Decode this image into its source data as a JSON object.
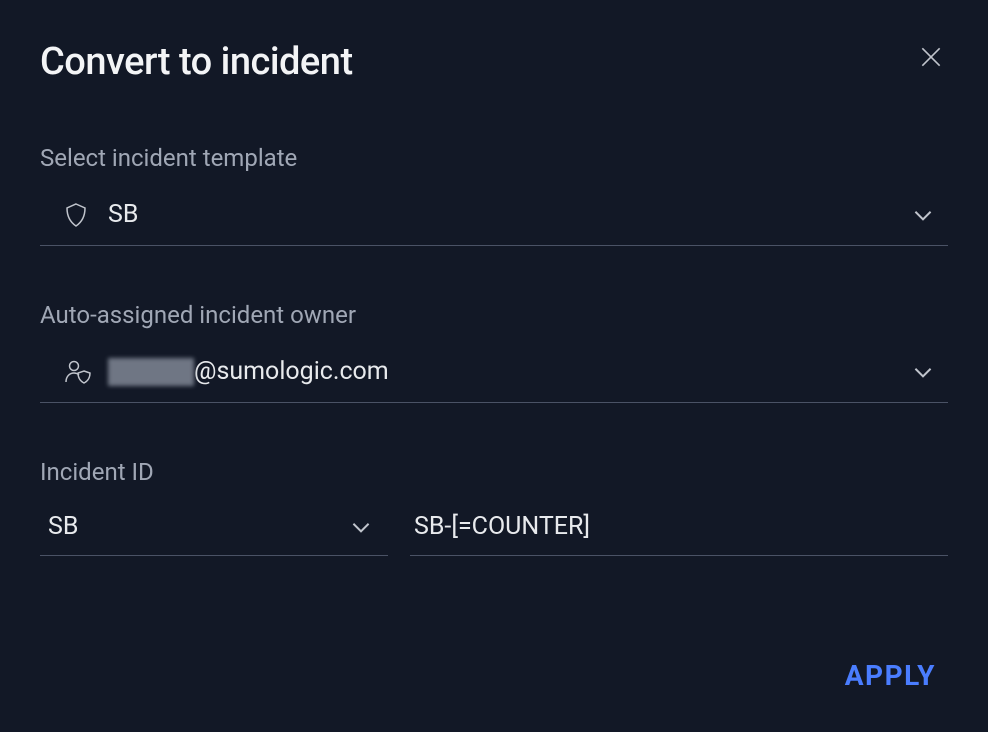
{
  "header": {
    "title": "Convert to incident"
  },
  "template": {
    "label": "Select incident template",
    "value": "SB"
  },
  "owner": {
    "label": "Auto-assigned incident owner",
    "domain": "@sumologic.com"
  },
  "incidentId": {
    "label": "Incident ID",
    "prefixValue": "SB",
    "patternValue": "SB-[=COUNTER]"
  },
  "actions": {
    "apply": "APPLY"
  }
}
